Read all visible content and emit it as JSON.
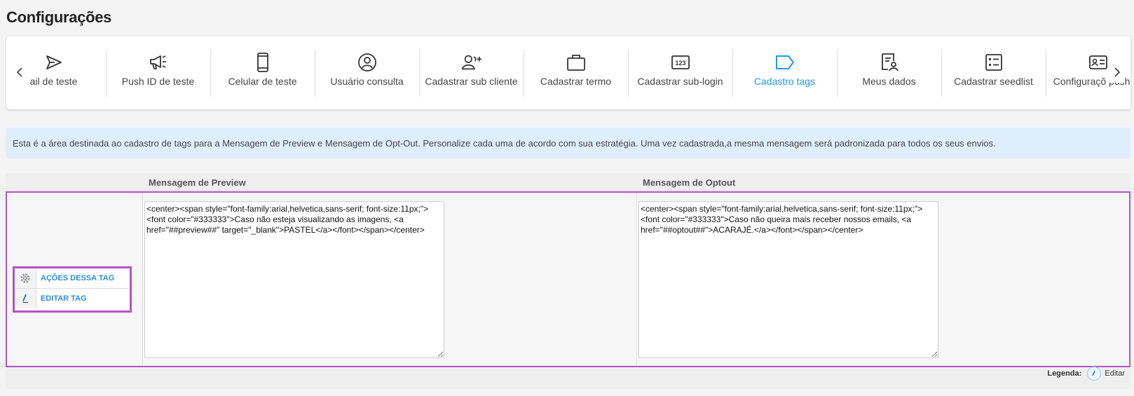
{
  "page": {
    "title": "Configurações"
  },
  "carousel": {
    "items": [
      {
        "label": "ail de teste",
        "icon": "send-icon"
      },
      {
        "label": "Push ID de teste",
        "icon": "megaphone-icon"
      },
      {
        "label": "Celular de teste",
        "icon": "smartphone-icon"
      },
      {
        "label": "Usuário consulta",
        "icon": "user-circle-icon"
      },
      {
        "label": "Cadastrar sub cliente",
        "icon": "user-plus-icon"
      },
      {
        "label": "Cadastrar termo",
        "icon": "briefcase-icon"
      },
      {
        "label": "Cadastrar sub-login",
        "icon": "numbers-123-icon"
      },
      {
        "label": "Cadastro tags",
        "icon": "tag-icon",
        "active": true
      },
      {
        "label": "Meus dados",
        "icon": "user-document-icon"
      },
      {
        "label": "Cadastrar seedlist",
        "icon": "list-checklist-icon"
      },
      {
        "label": "Configuraçõ push ID",
        "icon": "id-card-icon"
      }
    ],
    "accent_color": "#1e9be6"
  },
  "info": {
    "text": "Esta é a área destinada ao cadastro de tags para a Mensagem de Preview e Mensagem de Opt-Out. Personalize cada uma de acordo com sua estratégia. Uma vez cadastrada,a mesma mensagem será padronizada para todos os seus envios."
  },
  "table": {
    "headers": {
      "preview": "Mensagem de Preview",
      "optout": "Mensagem de Optout"
    },
    "row": {
      "actions_label": "AÇÕES DESSA TAG",
      "edit_label": "EDITAR TAG",
      "preview_value": "<center><span style=\"font-family:arial,helvetica,sans-serif; font-size:11px;\"><font color=\"#333333\">Caso não esteja visualizando as imagens, <a href=\"##preview##\" target=\"_blank\">PASTEL</a></font></span></center>",
      "optout_value": "<center><span style=\"font-family:arial,helvetica,sans-serif; font-size:11px;\"><font color=\"#333333\">Caso não queira mais receber nossos emails, <a href=\"##optout##\">ACARAJÉ.</a></font></span></center>"
    },
    "highlight_color": "#b454c4"
  },
  "legend": {
    "title": "Legenda:",
    "edit_label": "Editar"
  }
}
